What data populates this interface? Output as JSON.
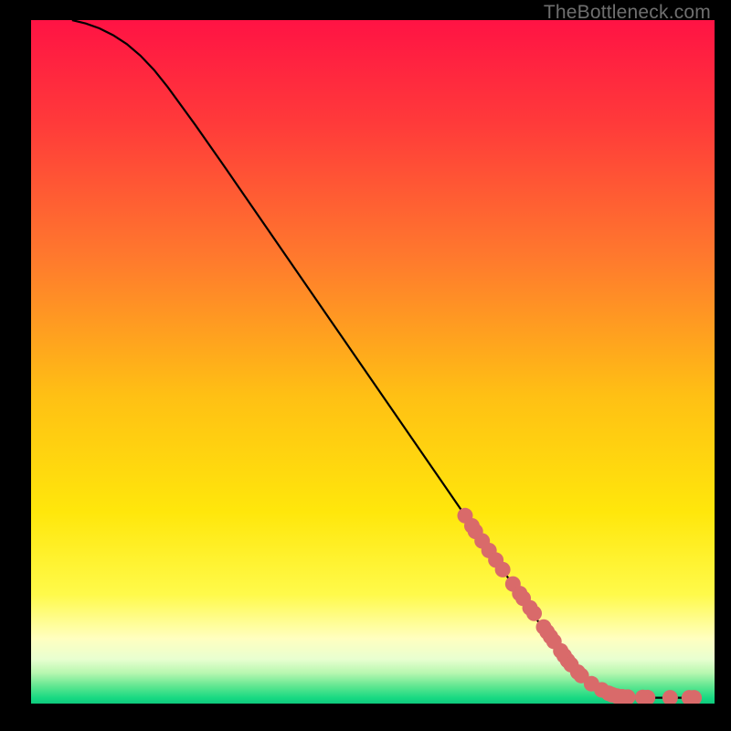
{
  "watermark": "TheBottleneck.com",
  "chart_data": {
    "type": "line",
    "title": "",
    "xlabel": "",
    "ylabel": "",
    "xlim": [
      0,
      100
    ],
    "ylim": [
      0,
      100
    ],
    "grid": false,
    "gradient_stops": [
      {
        "offset": 0.0,
        "color": "#ff1344"
      },
      {
        "offset": 0.15,
        "color": "#ff3a3a"
      },
      {
        "offset": 0.35,
        "color": "#ff7a2d"
      },
      {
        "offset": 0.55,
        "color": "#ffc014"
      },
      {
        "offset": 0.72,
        "color": "#ffe70b"
      },
      {
        "offset": 0.84,
        "color": "#fffa4a"
      },
      {
        "offset": 0.905,
        "color": "#ffffc0"
      },
      {
        "offset": 0.935,
        "color": "#e8ffd0"
      },
      {
        "offset": 0.955,
        "color": "#b8f7b0"
      },
      {
        "offset": 0.975,
        "color": "#5ee690"
      },
      {
        "offset": 0.992,
        "color": "#17d982"
      },
      {
        "offset": 1.0,
        "color": "#0fc97d"
      }
    ],
    "series": [
      {
        "name": "curve",
        "type": "line",
        "color": "#000000",
        "x": [
          6,
          8,
          10,
          12,
          14,
          16,
          18,
          20,
          24,
          28,
          32,
          36,
          40,
          44,
          48,
          52,
          56,
          60,
          64,
          68,
          72,
          76,
          78,
          80,
          82,
          83.5,
          85,
          87,
          90,
          97
        ],
        "y": [
          100,
          99.5,
          98.8,
          97.8,
          96.5,
          94.8,
          92.7,
          90.2,
          84.7,
          79.0,
          73.2,
          67.4,
          61.6,
          55.8,
          50.0,
          44.2,
          38.4,
          32.6,
          26.8,
          21.0,
          15.2,
          9.4,
          6.8,
          4.6,
          2.9,
          2.0,
          1.4,
          1.0,
          0.85,
          0.85
        ]
      },
      {
        "name": "highlight-points",
        "type": "scatter",
        "color": "#d96a6a",
        "x": [
          63.5,
          64.5,
          65.0,
          66.0,
          67.0,
          68.0,
          69.0,
          70.5,
          71.5,
          72.0,
          73.0,
          73.6,
          75.0,
          75.5,
          76.0,
          76.5,
          77.5,
          78.0,
          78.5,
          79.0,
          80.0,
          80.5,
          82.0,
          83.5,
          84.5,
          85.0,
          85.7,
          86.5,
          87.3,
          89.5,
          90.2,
          93.5,
          96.3,
          97.0
        ],
        "y": [
          27.5,
          26.0,
          25.2,
          23.8,
          22.4,
          21.0,
          19.6,
          17.5,
          16.1,
          15.4,
          14.0,
          13.2,
          11.2,
          10.5,
          9.8,
          9.1,
          7.7,
          7.0,
          6.3,
          5.7,
          4.6,
          4.1,
          2.9,
          2.0,
          1.5,
          1.3,
          1.1,
          1.0,
          0.95,
          0.9,
          0.88,
          0.85,
          0.85,
          0.85
        ]
      }
    ]
  }
}
